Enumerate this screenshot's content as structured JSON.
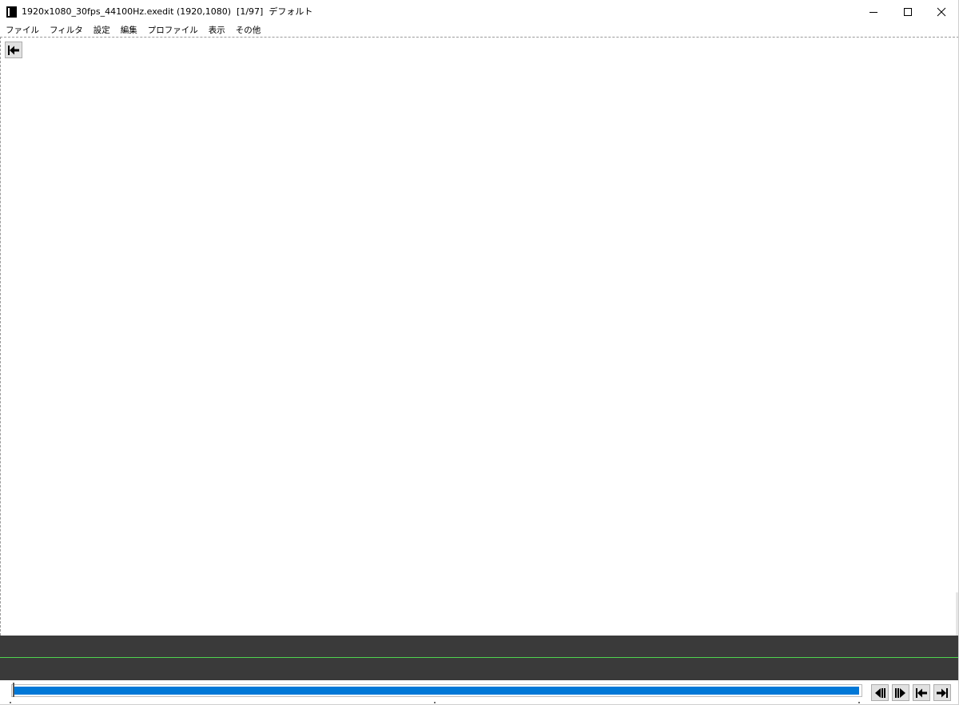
{
  "window": {
    "title": "1920x1080_30fps_44100Hz.exedit (1920,1080)  [1/97]  デフォルト"
  },
  "menu": {
    "items": [
      "ファイル",
      "フィルタ",
      "設定",
      "編集",
      "プロファイル",
      "表示",
      "その他"
    ]
  },
  "seek": {
    "fill_fraction": 1.0,
    "current_frame": 1,
    "total_frames": 97
  },
  "colors": {
    "accent": "#0078d7",
    "timeline_bg": "#3a3a3a",
    "timeline_line": "#4fd44f"
  },
  "icons": {
    "app": "app-icon",
    "minimize": "minimize-icon",
    "maximize": "maximize-icon",
    "close": "close-icon",
    "back": "jump-to-start-icon",
    "prev": "previous-frame-icon",
    "next": "next-frame-icon",
    "first": "first-frame-icon",
    "last": "last-frame-icon"
  }
}
